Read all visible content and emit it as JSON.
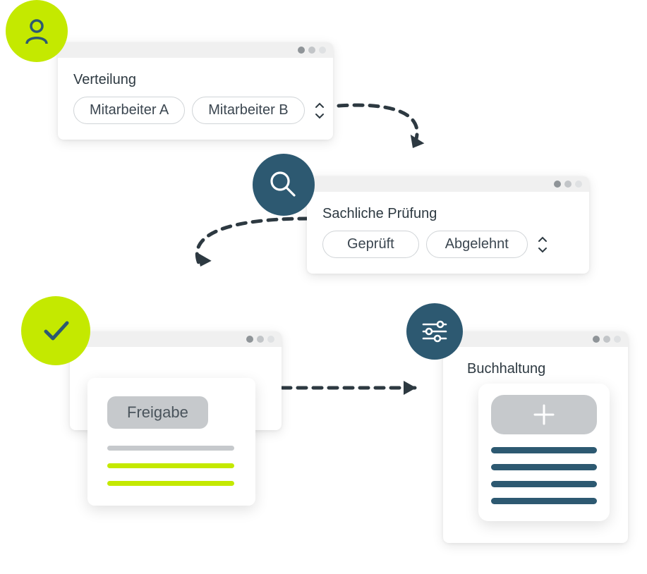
{
  "colors": {
    "lime": "#c4e900",
    "teal": "#2d5971",
    "dot_dark": "#8f9498",
    "dot_mid": "#c2c5c8",
    "dot_light": "#dfe1e3",
    "grey_line": "#c6c9cc"
  },
  "windows": {
    "verteilung": {
      "title": "Verteilung",
      "chips": [
        "Mitarbeiter A",
        "Mitarbeiter B"
      ],
      "badge_icon": "user-icon"
    },
    "pruefung": {
      "title": "Sachliche Prüfung",
      "chips": [
        "Geprüft",
        "Abgelehnt"
      ],
      "badge_icon": "search-icon"
    },
    "freigabe": {
      "button_label": "Freigabe",
      "badge_icon": "check-icon"
    },
    "buchhaltung": {
      "title": "Buchhaltung",
      "badge_icon": "sliders-icon"
    }
  }
}
